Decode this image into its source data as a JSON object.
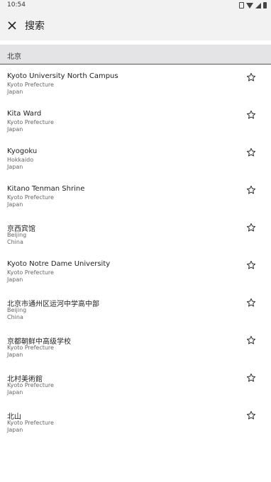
{
  "status_bar": {
    "time": "10:54"
  },
  "app_bar": {
    "close_icon": "close-icon",
    "title": "搜索"
  },
  "section": {
    "title": "北京"
  },
  "results": [
    {
      "name": "Kyoto University North Campus",
      "region": "Kyoto Prefecture",
      "country": "Japan"
    },
    {
      "name": "Kita Ward",
      "region": "Kyoto Prefecture",
      "country": "Japan"
    },
    {
      "name": "Kyogoku",
      "region": "Hokkaido",
      "country": "Japan"
    },
    {
      "name": "Kitano Tenman Shrine",
      "region": "Kyoto Prefecture",
      "country": "Japan"
    },
    {
      "name": "京西宾馆",
      "region": "Beijing",
      "country": "China"
    },
    {
      "name": "Kyoto Notre Dame University",
      "region": "Kyoto Prefecture",
      "country": "Japan"
    },
    {
      "name": "北京市通州区运河中学高中部",
      "region": "Beijing",
      "country": "China"
    },
    {
      "name": "京都朝鲜中高级学校",
      "region": "Kyoto Prefecture",
      "country": "Japan"
    },
    {
      "name": "北村美術館",
      "region": "Kyoto Prefecture",
      "country": "Japan"
    },
    {
      "name": "北山",
      "region": "Kyoto Prefecture",
      "country": "Japan"
    }
  ]
}
